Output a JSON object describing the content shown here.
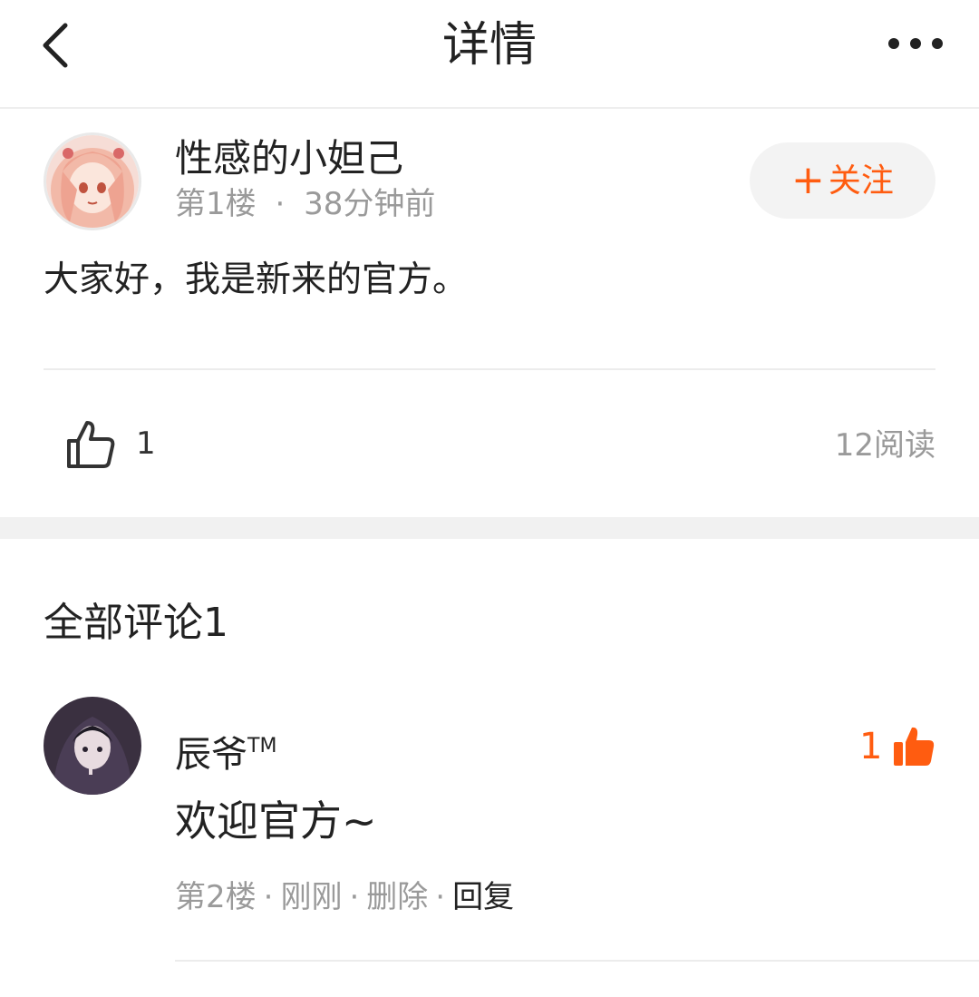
{
  "header": {
    "title": "详情",
    "back_icon": "chevron-left-icon",
    "more_icon": "more-horizontal-icon"
  },
  "post": {
    "author_name": "性感的小妲己",
    "floor": "第1楼",
    "meta_separator": "·",
    "time": "38分钟前",
    "follow_label": "关注",
    "follow_plus": "+",
    "content": "大家好，我是新来的官方。",
    "like_count": "1",
    "read_count": "12阅读"
  },
  "comments": {
    "title": "全部评论1",
    "items": [
      {
        "author_name": "辰爷",
        "author_badge": "TM",
        "like_count": "1",
        "text": "欢迎官方~",
        "floor": "第2楼",
        "time": "刚刚",
        "delete_label": "删除",
        "reply_label": "回复",
        "separator": "·"
      }
    ]
  },
  "colors": {
    "accent": "#ff5c10",
    "muted_text": "#9a9a9a",
    "primary_text": "#222222",
    "divider": "#ececec"
  }
}
